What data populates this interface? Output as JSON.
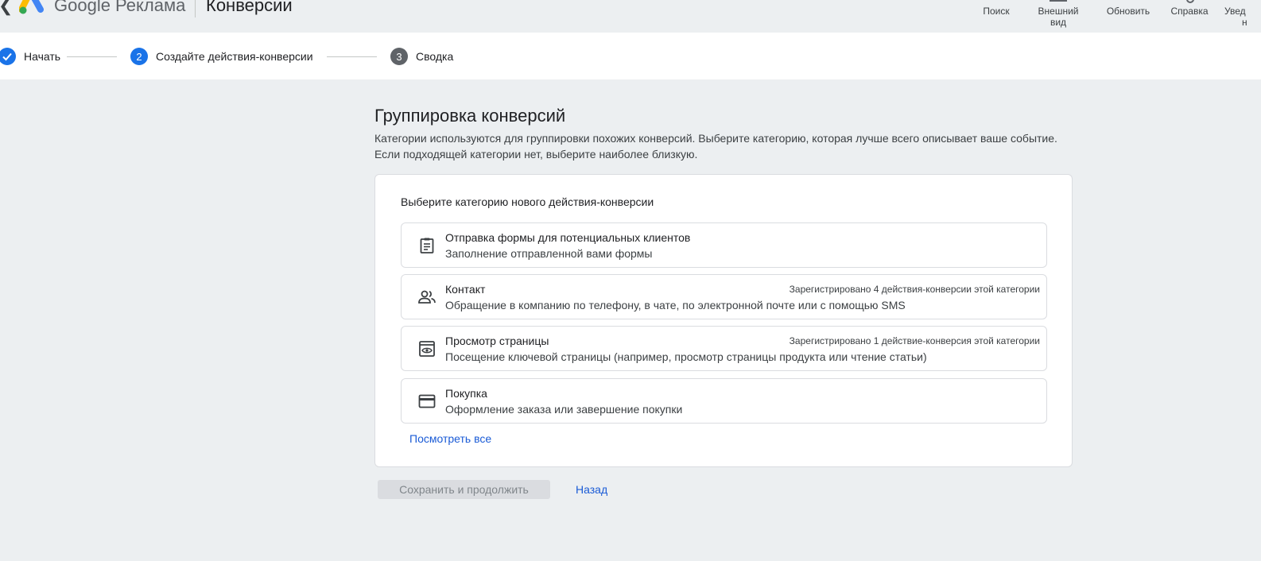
{
  "header": {
    "back_icon": "arrow-back-icon",
    "brand": "Google Реклама",
    "title": "Конверсии",
    "tools": {
      "search": "Поиск",
      "view_line1": "Внешний",
      "view_line2": "вид",
      "refresh": "Обновить",
      "help": "Справка",
      "notifications_line1": "Увед",
      "notifications_line2": "н"
    }
  },
  "stepper": {
    "steps": [
      {
        "number": "",
        "label": "Начать",
        "state": "done"
      },
      {
        "number": "2",
        "label": "Создайте действия-конверсии",
        "state": "active"
      },
      {
        "number": "3",
        "label": "Сводка",
        "state": "pending"
      }
    ]
  },
  "main": {
    "title": "Группировка конверсий",
    "description": "Категории используются для группировки похожих конверсий. Выберите категорию, которая лучше всего описывает ваше событие. Если подходящей категории нет, выберите наиболее близкую.",
    "card_title": "Выберите категорию нового действия-конверсии",
    "options": [
      {
        "icon": "clipboard-icon",
        "name": "Отправка формы для потенциальных клиентов",
        "desc": "Заполнение отправленной вами формы",
        "count": ""
      },
      {
        "icon": "people-icon",
        "name": "Контакт",
        "desc": "Обращение в компанию по телефону, в чате, по электронной почте или с помощью SMS",
        "count": "Зарегистрировано 4 действия-конверсии этой категории"
      },
      {
        "icon": "page-view-icon",
        "name": "Просмотр страницы",
        "desc": "Посещение ключевой страницы (например, просмотр страницы продукта или чтение статьи)",
        "count": "Зарегистрировано 1 действие-конверсия этой категории"
      },
      {
        "icon": "credit-card-icon",
        "name": "Покупка",
        "desc": "Оформление заказа или завершение покупки",
        "count": ""
      }
    ],
    "see_all": "Посмотреть все",
    "save_button": "Сохранить и продолжить",
    "back_link": "Назад"
  },
  "colors": {
    "accent": "#1a73e8",
    "link": "#1a5bd6",
    "background": "#eceff1"
  }
}
